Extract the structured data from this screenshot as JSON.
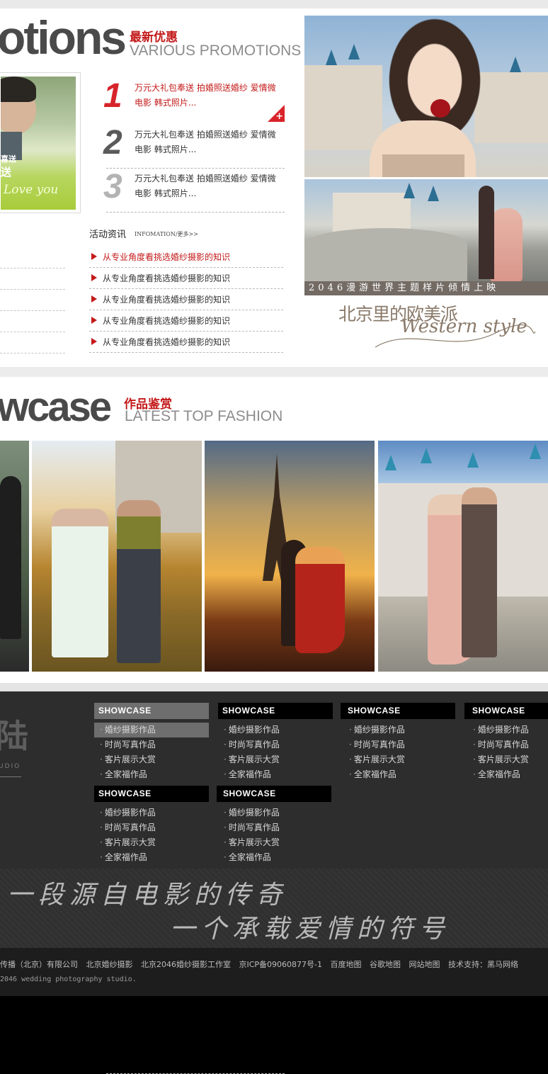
{
  "promotions": {
    "title_en_big": "otions",
    "title_cn": "最新优惠",
    "subtitle_en": "VARIOUS PROMOTIONS",
    "left_photo_text_1": "喜送",
    "left_photo_text_2": "送",
    "ranks": [
      {
        "num": "1",
        "text": "万元大礼包奉送  拍婚照送婚纱  爱情微电影  韩式照片..."
      },
      {
        "num": "2",
        "text": "万元大礼包奉送  拍婚照送婚纱  爱情微电影  韩式照片..."
      },
      {
        "num": "3",
        "text": "万元大礼包奉送  拍婚照送婚纱  爱情微电影  韩式照片..."
      }
    ],
    "plus": "+",
    "news_heading": "活动资讯",
    "news_more": "INFOMATION/更多>>",
    "news_items": [
      "从专业角度看挑选婚纱摄影的知识",
      "从专业角度看挑选婚纱摄影的知识",
      "从专业角度看挑选婚纱摄影的知识",
      "从专业角度看挑选婚纱摄影的知识",
      "从专业角度看挑选婚纱摄影的知识"
    ],
    "feature_caption": "2046漫游世界主题样片倾情上映",
    "feature_title": "北京里的欧美派",
    "feature_script": "Western style"
  },
  "showcase": {
    "title_en_big": "wcase",
    "title_cn": "作品鉴赏",
    "subtitle_en": "LATEST  TOP FASHION"
  },
  "footer": {
    "logo_char": "陆",
    "logo_en": "UDIO",
    "columns": [
      {
        "head": "SHOWCASE",
        "items": [
          "婚纱摄影作品",
          "时尚写真作品",
          "客片展示大赏",
          "全家福作品"
        ]
      },
      {
        "head": "SHOWCASE",
        "items": [
          "婚纱摄影作品",
          "时尚写真作品",
          "客片展示大赏",
          "全家福作品"
        ]
      },
      {
        "head": "SHOWCASE",
        "items": [
          "婚纱摄影作品",
          "时尚写真作品",
          "客片展示大赏",
          "全家福作品"
        ]
      },
      {
        "head": "SHOWCASE",
        "items": [
          "婚纱摄影作品",
          "时尚写真作品",
          "客片展示大赏",
          "全家福作品"
        ]
      },
      {
        "head": "SHOWCASE",
        "items": [
          "婚纱摄影作品",
          "时尚写真作品",
          "客片展示大赏",
          "全家福作品"
        ]
      },
      {
        "head": "SHOWCASE",
        "items": [
          "婚纱摄影作品",
          "时尚写真作品",
          "客片展示大赏",
          "全家福作品"
        ]
      }
    ],
    "slogan_line_1": "一段源自电影的传奇",
    "slogan_line_2": "一个承载爱情的符号",
    "copyright_links": [
      "传播（北京）有限公司",
      "北京婚纱摄影",
      "北京2046婚纱摄影工作室",
      "京ICP备09060877号-1",
      "百度地图",
      "谷歌地图",
      "网站地图",
      "技术支持：黑马网络"
    ],
    "copyright_line_2": "2046 wedding photography studio."
  },
  "colors": {
    "accent_red": "#c41a1a",
    "title_gray": "#4a4a4a",
    "footer_bg": "#2d2d2d",
    "active_gray": "#6e6e6e"
  }
}
